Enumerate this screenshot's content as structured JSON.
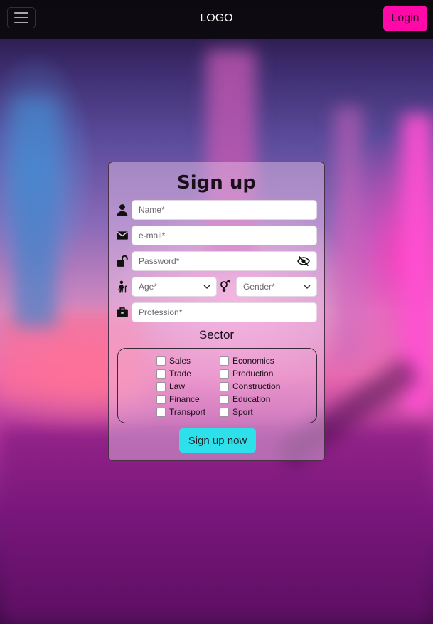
{
  "navbar": {
    "logo": "LOGO",
    "login_label": "Login",
    "menu_icon": "hamburger-icon"
  },
  "form": {
    "title": "Sign up",
    "name_placeholder": "Name*",
    "email_placeholder": "e-mail*",
    "password_placeholder": "Password*",
    "age_label": "Age*",
    "gender_label": "Gender*",
    "profession_placeholder": "Profession*",
    "sector_title": "Sector",
    "sectors_left": [
      "Sales",
      "Trade",
      "Law",
      "Finance",
      "Transport"
    ],
    "sectors_right": [
      "Economics",
      "Production",
      "Construction",
      "Education",
      "Sport"
    ],
    "submit_label": "Sign up now"
  },
  "colors": {
    "login_button": "#ff0aa8",
    "submit_button": "#2ee0ea",
    "navbar": "#0c0a0e"
  }
}
